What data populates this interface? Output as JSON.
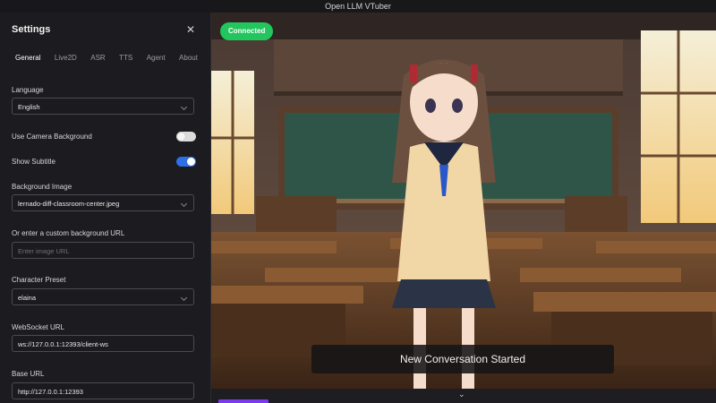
{
  "window": {
    "title": "Open LLM VTuber"
  },
  "settings": {
    "title": "Settings",
    "tabs": [
      "General",
      "Live2D",
      "ASR",
      "TTS",
      "Agent",
      "About"
    ],
    "active_tab": "General",
    "language": {
      "label": "Language",
      "value": "English"
    },
    "camera_background": {
      "label": "Use Camera Background",
      "enabled": false
    },
    "show_subtitle": {
      "label": "Show Subtitle",
      "enabled": true
    },
    "background_image": {
      "label": "Background Image",
      "value": "lernado-diff-classroom-center.jpeg"
    },
    "custom_bg_url": {
      "label": "Or enter a custom background URL",
      "placeholder": "Enter image URL"
    },
    "character_preset": {
      "label": "Character Preset",
      "value": "elaina"
    },
    "websocket_url": {
      "label": "WebSocket URL",
      "value": "ws://127.0.0.1:12393/client-ws"
    },
    "base_url": {
      "label": "Base URL",
      "value": "http://127.0.0.1:12393"
    }
  },
  "stage": {
    "status_badge": "Connected",
    "subtitle": "New Conversation Started"
  },
  "colors": {
    "connected": "#22c55e",
    "toggle_on": "#2f6fe8",
    "accent": "#7c3aed"
  }
}
